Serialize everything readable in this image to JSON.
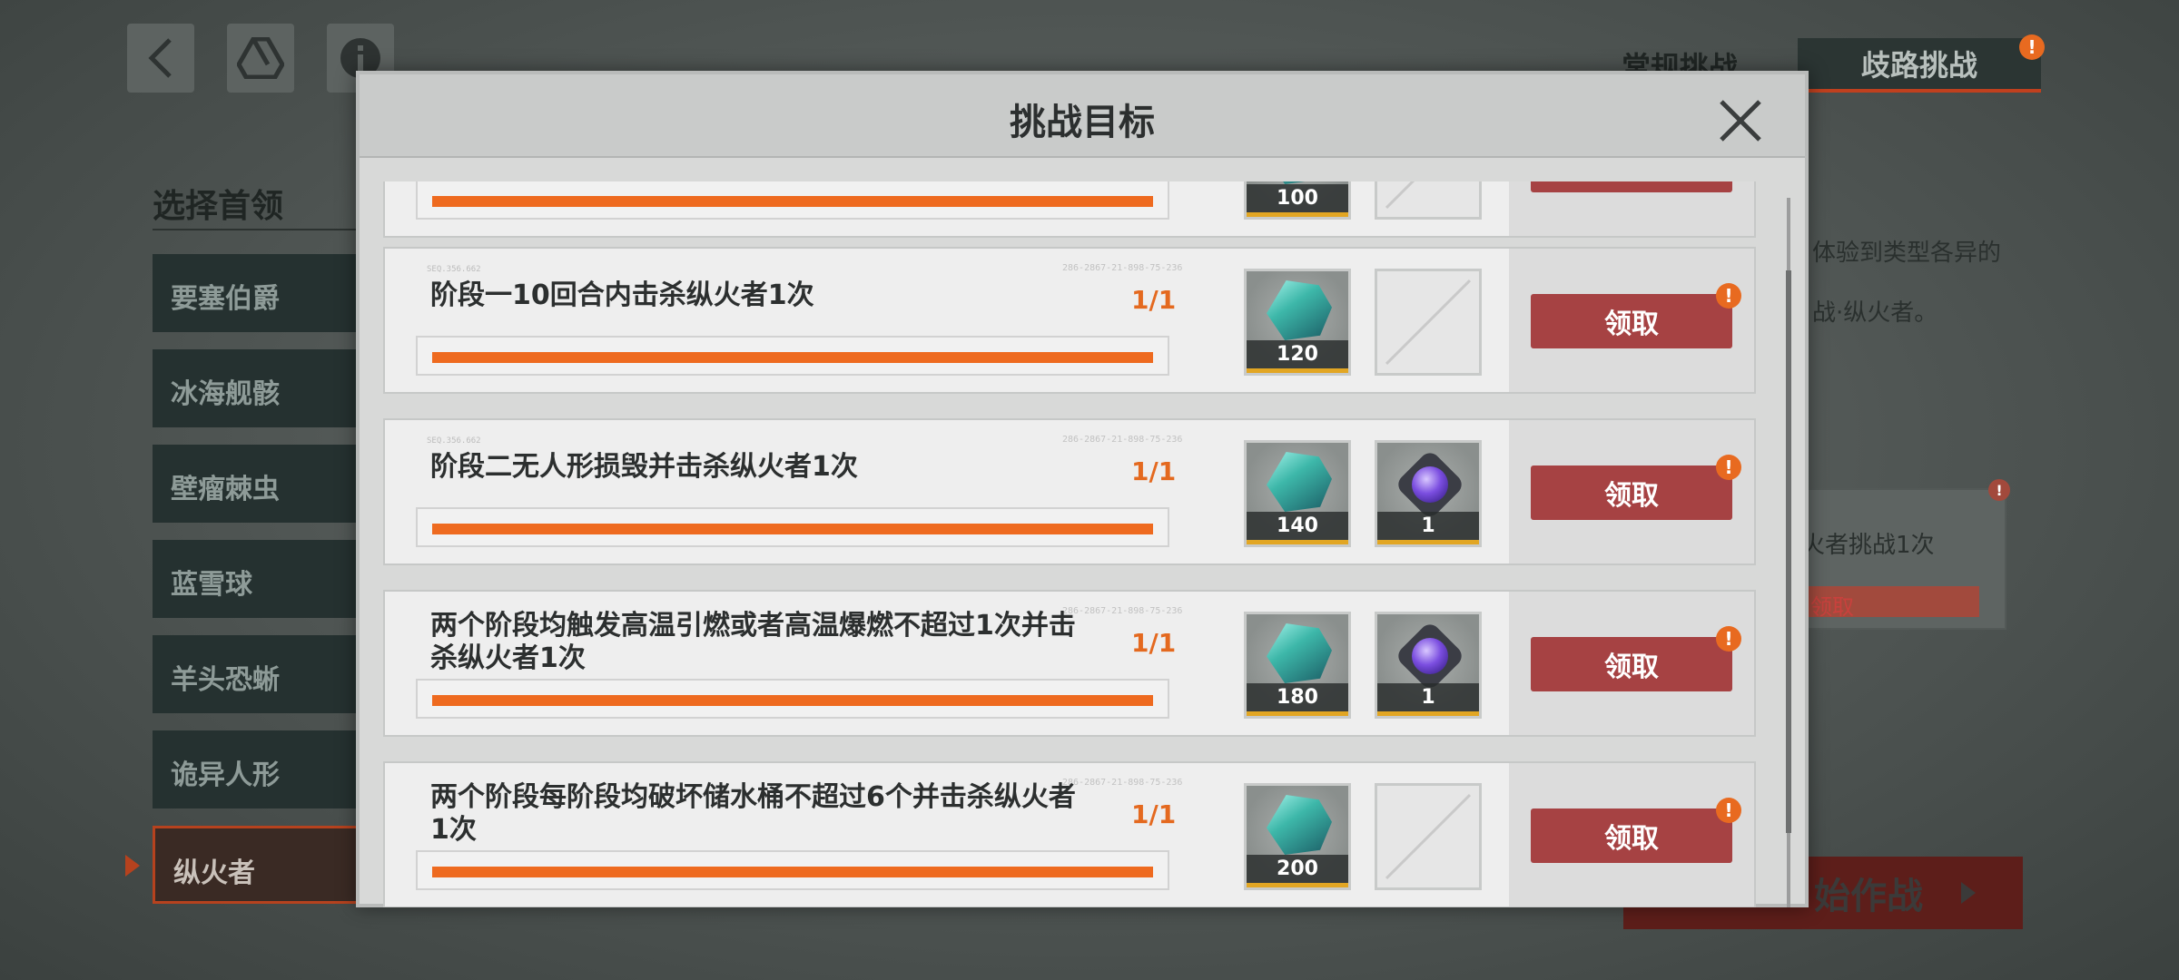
{
  "background": {
    "top_icons": [
      "back-icon",
      "drive-icon",
      "info-icon"
    ],
    "section_title": "选择首领",
    "bosses": [
      "要塞伯爵",
      "冰海舰骸",
      "壁瘤棘虫",
      "蓝雪球",
      "羊头恐蜥",
      "诡异人形",
      "纵火者"
    ],
    "active_boss": "纵火者",
    "tabs": {
      "normal": "常规挑战",
      "branch": "歧路挑战"
    },
    "desc_line1": "体验到类型各异的",
    "desc_line2": "战·纵火者。",
    "card_text": "火者挑战1次",
    "card_claim": "领取",
    "start_label": "始作战"
  },
  "modal": {
    "title": "挑战目标",
    "tasks": [
      {
        "text": "",
        "progress": "",
        "fill": 1.0,
        "rewards": [
          {
            "kind": "gem",
            "qty": "100"
          },
          {
            "kind": "empty",
            "qty": ""
          }
        ],
        "claim": "领取",
        "alert": false
      },
      {
        "text": "阶段一10回合内击杀纵火者1次",
        "progress": "1/1",
        "fill": 1.0,
        "rewards": [
          {
            "kind": "gem",
            "qty": "120"
          },
          {
            "kind": "empty",
            "qty": ""
          }
        ],
        "claim": "领取",
        "alert": true
      },
      {
        "text": "阶段二无人形损毁并击杀纵火者1次",
        "progress": "1/1",
        "fill": 1.0,
        "rewards": [
          {
            "kind": "gem",
            "qty": "140"
          },
          {
            "kind": "orb",
            "qty": "1"
          }
        ],
        "claim": "领取",
        "alert": true
      },
      {
        "text": "两个阶段均触发高温引燃或者高温爆燃不超过1次并击杀纵火者1次",
        "progress": "1/1",
        "fill": 1.0,
        "rewards": [
          {
            "kind": "gem",
            "qty": "180"
          },
          {
            "kind": "orb",
            "qty": "1"
          }
        ],
        "claim": "领取",
        "alert": true
      },
      {
        "text": "两个阶段每阶段均破坏储水桶不超过6个并击杀纵火者1次",
        "progress": "1/1",
        "fill": 1.0,
        "rewards": [
          {
            "kind": "gem",
            "qty": "200"
          },
          {
            "kind": "empty",
            "qty": ""
          }
        ],
        "claim": "领取",
        "alert": true
      }
    ]
  },
  "colors": {
    "accent_orange": "#ee6a1f",
    "claim_red": "#a64243",
    "alert_orange": "#e86a20"
  }
}
